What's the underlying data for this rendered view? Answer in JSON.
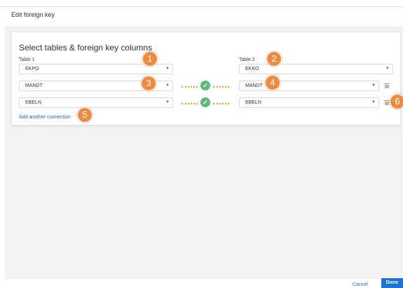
{
  "dialog": {
    "title": "Edit foreign key"
  },
  "card": {
    "title": "Select tables & foreign key columns",
    "table1_label": "Table 1",
    "table2_label": "Table 2",
    "table1_value": "EKPO",
    "table2_value": "EKKO",
    "connections": [
      {
        "left": "MANDT",
        "right": "MANDT"
      },
      {
        "left": "EBELN",
        "right": "EBELN"
      }
    ],
    "add_connection": "Add another connection"
  },
  "badges": [
    "1",
    "2",
    "3",
    "4",
    "5",
    "6"
  ],
  "footer": {
    "cancel": "Cancel",
    "done": "Done"
  },
  "icons": {
    "caret": "▼",
    "check": "✔"
  },
  "colors": {
    "accent": "#1a73d9",
    "badge": "#f08a3e",
    "check": "#5fb878",
    "link": "#1a6fa8"
  }
}
